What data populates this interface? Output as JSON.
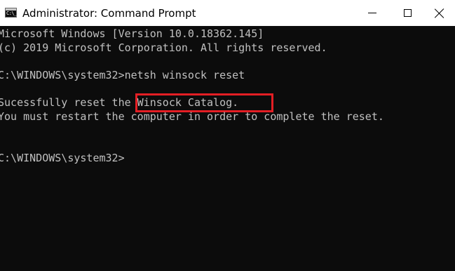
{
  "window": {
    "title": "Administrator: Command Prompt",
    "icon_text": "C:\\_"
  },
  "controls": {
    "minimize": "minimize-icon",
    "maximize": "maximize-icon",
    "close": "close-icon"
  },
  "console": {
    "lines": [
      "Microsoft Windows [Version 10.0.18362.145]",
      "(c) 2019 Microsoft Corporation. All rights reserved.",
      "C:\\WINDOWS\\system32>netsh winsock reset",
      "Sucessfully reset the Winsock Catalog.",
      "You must restart the computer in order to complete the reset.",
      "C:\\WINDOWS\\system32>"
    ]
  },
  "colors": {
    "console_background": "#0c0c0c",
    "console_text": "#c0c0c0",
    "highlight_border": "#e31e24",
    "titlebar_background": "#ffffff"
  }
}
